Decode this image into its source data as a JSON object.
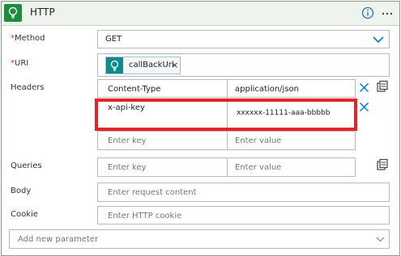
{
  "header": {
    "title": "HTTP",
    "info_icon": "info-icon",
    "more_icon": "more-options-icon",
    "logo_icon": "lightbulb-icon"
  },
  "fields": {
    "method": {
      "label": "Method",
      "required_mark": "*",
      "value": "GET"
    },
    "uri": {
      "label": "URI",
      "required_mark": "*",
      "token": "callBackUrl",
      "token_remove": "×"
    },
    "headers": {
      "label": "Headers",
      "rows": [
        {
          "key": "Content-Type",
          "value": "application/json"
        },
        {
          "key": "x-api-key",
          "value": "xxxxxx-11111-aaa-bbbbb"
        }
      ],
      "key_placeholder": "Enter key",
      "value_placeholder": "Enter value"
    },
    "queries": {
      "label": "Queries",
      "key_placeholder": "Enter key",
      "value_placeholder": "Enter value"
    },
    "body": {
      "label": "Body",
      "placeholder": "Enter request content"
    },
    "cookie": {
      "label": "Cookie",
      "placeholder": "Enter HTTP cookie"
    }
  },
  "add_parameter": {
    "placeholder": "Add new parameter"
  },
  "colors": {
    "header_bg": "#eef3ee",
    "logo_green": "#1b8e3b",
    "token_teal": "#0f8b8d",
    "accent_blue": "#0078d4",
    "highlight_red": "#e8212a"
  }
}
